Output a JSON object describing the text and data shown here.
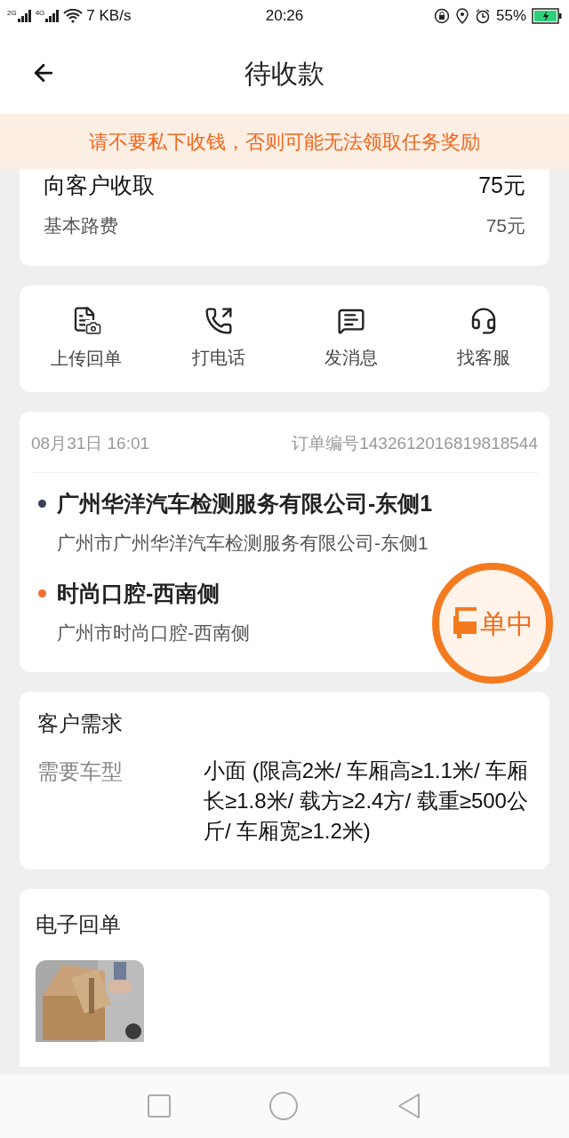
{
  "status_bar": {
    "signal_labels": [
      "2G",
      "4G"
    ],
    "speed": "7 KB/s",
    "time": "20:26",
    "battery": "55%"
  },
  "header": {
    "title": "待收款"
  },
  "notice": "请不要私下收钱，否则可能无法领取任务奖励",
  "fee": {
    "rows": [
      {
        "kind": "total",
        "label": "向客户收取",
        "amount": "75元"
      },
      {
        "kind": "item",
        "label": "基本路费",
        "amount": "75元"
      }
    ]
  },
  "actions": [
    {
      "kind": "upload",
      "label": "上传回单"
    },
    {
      "kind": "call",
      "label": "打电话"
    },
    {
      "kind": "message",
      "label": "发消息"
    },
    {
      "kind": "service",
      "label": "找客服"
    }
  ],
  "order": {
    "time": "08月31日 16:01",
    "number": "订单编号1432612016819818544",
    "stops": [
      {
        "name": "广州华洋汽车检测服务有限公司-东侧1",
        "address": "广州市广州华洋汽车检测服务有限公司-东侧1",
        "color": "#3d3f55"
      },
      {
        "name": "时尚口腔-西南侧",
        "address": "广州市时尚口腔-西南侧",
        "color": "#f07030"
      }
    ]
  },
  "float_button": {
    "label": "单中"
  },
  "requirement": {
    "title": "客户需求",
    "label": "需要车型",
    "value": "小面 (限高2米/ 车厢高≥1.1米/ 车厢长≥1.8米/ 载方≥2.4方/ 载重≥500公斤/ 车厢宽≥1.2米)"
  },
  "receipt": {
    "title": "电子回单"
  }
}
